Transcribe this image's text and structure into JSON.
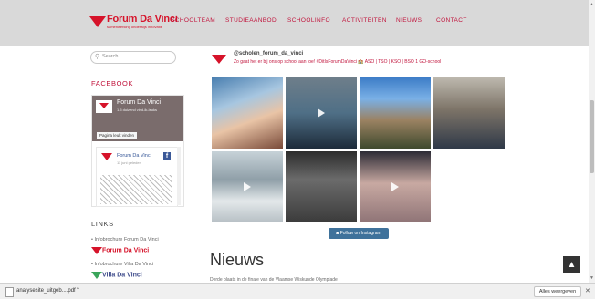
{
  "nav": {
    "brand_name": "Forum Da Vinci",
    "brand_tagline": "samenwerking onderwijs innovatie",
    "items": [
      "SCHOOLTEAM",
      "STUDIEAANBOD",
      "SCHOOLINFO",
      "ACTIVITEITEN",
      "NIEUWS",
      "CONTACT"
    ],
    "colors": {
      "bar": "#d9d9d9",
      "accent": "#c1143c",
      "brand_red": "#d6132a"
    }
  },
  "sidebar": {
    "search_placeholder": "Search",
    "facebook_title": "FACEBOOK",
    "fb_page_name": "Forum Da Vinci",
    "fb_page_sub": "1.5 duizend vind-ik-leuks",
    "fb_like_button": "Pagina leuk vinden",
    "fb_post_name": "Forum Da Vinci",
    "fb_post_sub": "11 juni geleden",
    "links_title": "LINKS",
    "links": [
      {
        "label": "Infobrochure Forum Da Vinci",
        "logo_name": "Forum Da Vinci"
      },
      {
        "label": "Infobrochure Villa Da Vinci",
        "logo_name": "Villa Da Vinci"
      }
    ]
  },
  "instagram": {
    "handle": "@scholen_forum_da_vinci",
    "bio": "Zo gaat het er bij ons op school aan toe! #DitIsForumDaVinci 🏫 ASO | TSO | KSO | BSO 1 GO-school",
    "follow_button": "Follow on Instagram",
    "tiles": [
      {
        "name": "selfie-photo",
        "video": false
      },
      {
        "name": "presentation-video",
        "video": true
      },
      {
        "name": "castle-photo",
        "video": false
      },
      {
        "name": "group-photo",
        "video": false
      },
      {
        "name": "snow-video",
        "video": true
      },
      {
        "name": "computer-class-photo",
        "video": false
      },
      {
        "name": "hands-video",
        "video": true
      }
    ]
  },
  "news": {
    "title": "Nieuws",
    "excerpt": "Derde plaats in de finale van de Vlaamse Wiskunde Olympiade"
  },
  "downloads": {
    "file_name": "analysesite_uitgeb....pdf",
    "show_all": "Alles weergeven"
  }
}
